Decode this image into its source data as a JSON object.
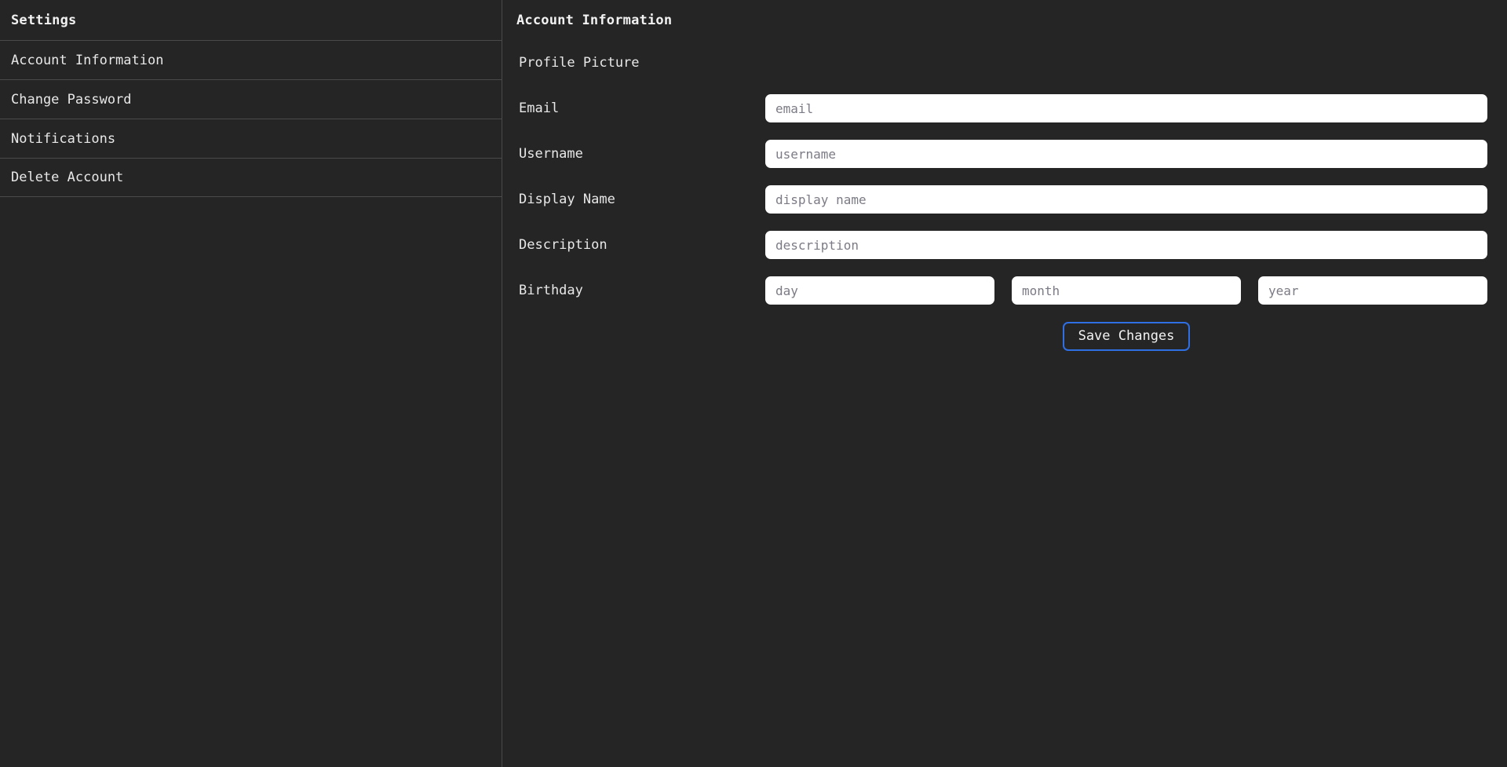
{
  "sidebar": {
    "title": "Settings",
    "items": [
      {
        "label": "Account Information"
      },
      {
        "label": "Change Password"
      },
      {
        "label": "Notifications"
      },
      {
        "label": "Delete Account"
      }
    ]
  },
  "main": {
    "title": "Account Information",
    "rows": {
      "profile_picture": {
        "label": "Profile Picture"
      },
      "email": {
        "label": "Email",
        "placeholder": "email",
        "value": ""
      },
      "username": {
        "label": "Username",
        "placeholder": "username",
        "value": ""
      },
      "display_name": {
        "label": "Display Name",
        "placeholder": "display name",
        "value": ""
      },
      "description": {
        "label": "Description",
        "placeholder": "description",
        "value": ""
      },
      "birthday": {
        "label": "Birthday",
        "day_placeholder": "day",
        "day_value": "",
        "month_placeholder": "month",
        "month_value": "",
        "year_placeholder": "year",
        "year_value": ""
      }
    },
    "save_label": "Save Changes"
  },
  "colors": {
    "background": "#252525",
    "divider": "#4a4a4a",
    "text": "#e8e8e8",
    "input_background": "#ffffff",
    "placeholder": "#7b7b86",
    "accent": "#2f6fe4"
  }
}
